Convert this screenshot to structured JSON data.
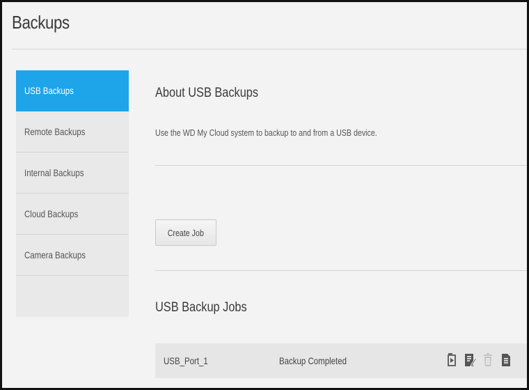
{
  "page": {
    "title": "Backups"
  },
  "sidebar": {
    "items": [
      {
        "label": "USB Backups",
        "active": true
      },
      {
        "label": "Remote Backups",
        "active": false
      },
      {
        "label": "Internal Backups",
        "active": false
      },
      {
        "label": "Cloud Backups",
        "active": false
      },
      {
        "label": "Camera Backups",
        "active": false
      }
    ]
  },
  "about": {
    "title": "About USB Backups",
    "description": "Use the WD My Cloud system to backup to and from a USB device."
  },
  "actions": {
    "create_job_label": "Create Job"
  },
  "jobs": {
    "title": "USB Backup Jobs",
    "rows": [
      {
        "name": "USB_Port_1",
        "status": "Backup Completed",
        "icons": [
          "restore-icon",
          "edit-icon",
          "delete-icon",
          "details-icon"
        ]
      }
    ]
  },
  "colors": {
    "accent": "#1ea4e8",
    "background": "#f3f3f3",
    "sidebar": "#e9e9e9",
    "icon": "#555555",
    "icon_disabled": "#c4c4c4"
  }
}
